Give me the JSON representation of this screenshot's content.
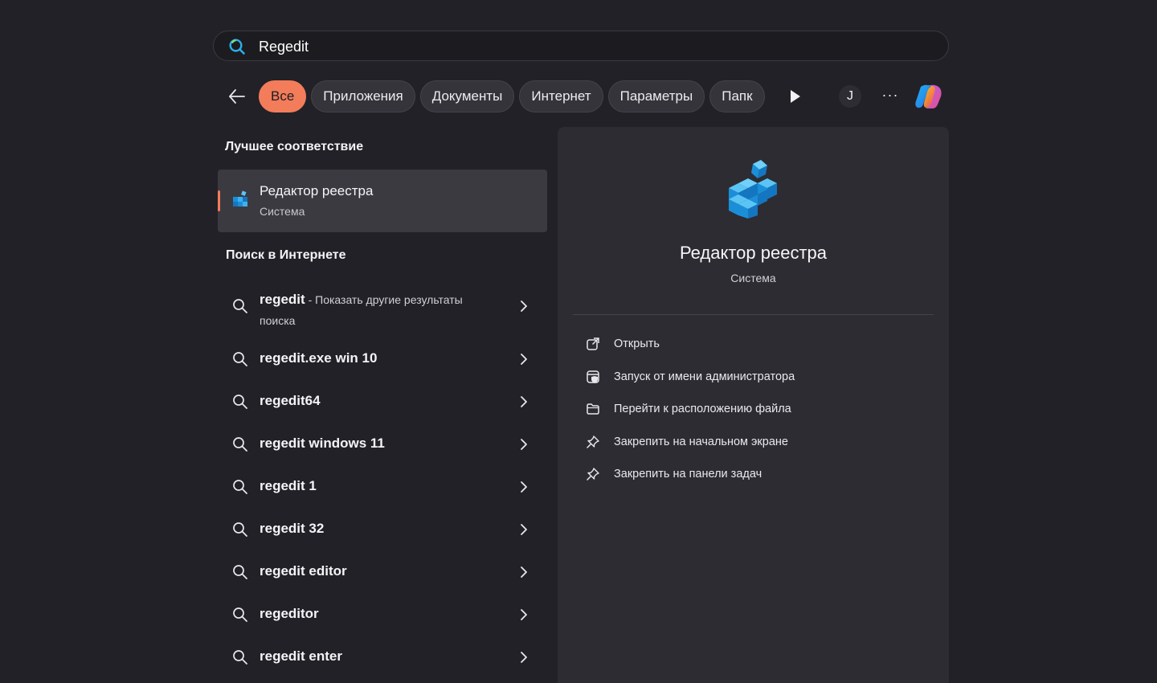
{
  "search": {
    "query": "Regedit"
  },
  "filters": {
    "chips": [
      "Все",
      "Приложения",
      "Документы",
      "Интернет",
      "Параметры",
      "Папк"
    ],
    "active_index": 0,
    "avatar_letter": "J",
    "more_label": "···"
  },
  "best_match": {
    "heading": "Лучшее соответствие",
    "name": "Редактор реестра",
    "type": "Система"
  },
  "web": {
    "heading": "Поиск в Интернете",
    "items": [
      {
        "query": "regedit",
        "suffix": " - Показать другие результаты поиска"
      },
      {
        "query": "regedit.exe win 10"
      },
      {
        "query": "regedit64"
      },
      {
        "query": "regedit windows 11"
      },
      {
        "query": "regedit 1"
      },
      {
        "query": "regedit 32"
      },
      {
        "query": "regedit editor"
      },
      {
        "query": "regeditor"
      },
      {
        "query": "regedit enter"
      }
    ]
  },
  "detail": {
    "title": "Редактор реестра",
    "subtitle": "Система",
    "actions": [
      {
        "label": "Открыть",
        "icon": "open-external-icon"
      },
      {
        "label": "Запуск от имени администратора",
        "icon": "admin-shield-icon"
      },
      {
        "label": "Перейти к расположению файла",
        "icon": "folder-icon"
      },
      {
        "label": "Закрепить на начальном экране",
        "icon": "pin-icon"
      },
      {
        "label": "Закрепить на панели задач",
        "icon": "pin-icon"
      }
    ]
  },
  "colors": {
    "background": "#222127",
    "panel": "#2d2c33",
    "accent": "#f37c5b",
    "registry_blue": "#1a8fd8"
  }
}
